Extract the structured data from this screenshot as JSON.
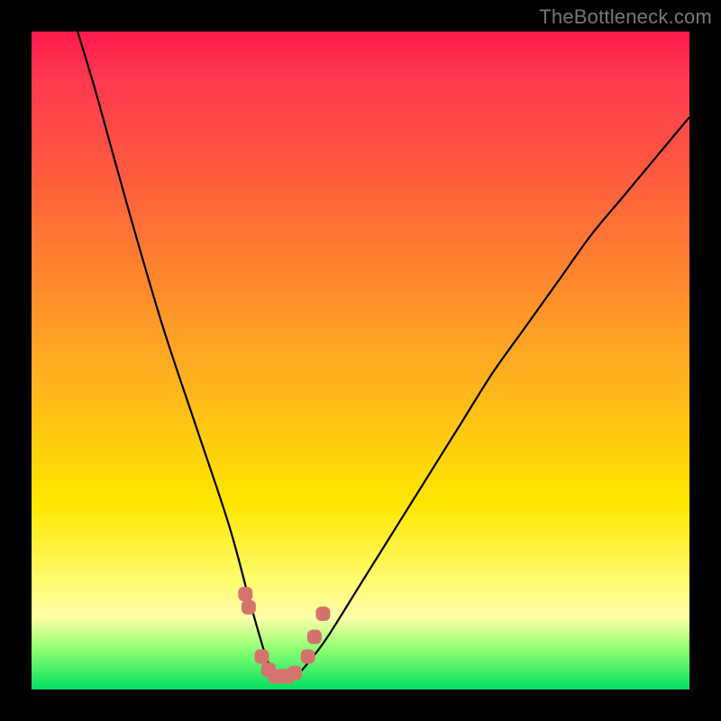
{
  "watermark": "TheBottleneck.com",
  "chart_data": {
    "type": "line",
    "title": "",
    "xlabel": "",
    "ylabel": "",
    "xlim": [
      0,
      100
    ],
    "ylim": [
      0,
      100
    ],
    "grid": false,
    "series": [
      {
        "name": "main-curve",
        "color": "#000000",
        "x": [
          7,
          10,
          15,
          20,
          25,
          30,
          33,
          35,
          36,
          37,
          38,
          40,
          42,
          45,
          50,
          55,
          60,
          65,
          70,
          75,
          80,
          85,
          90,
          95,
          100
        ],
        "y": [
          100,
          90,
          72,
          55,
          40,
          25,
          14,
          7,
          4,
          2,
          2,
          2,
          4,
          8,
          16,
          24,
          32,
          40,
          48,
          55,
          62,
          69,
          75,
          81,
          87
        ]
      },
      {
        "name": "trough-markers",
        "color": "#d4736e",
        "type": "scatter",
        "x": [
          32.5,
          33.0,
          35.0,
          36.0,
          37.0,
          38.0,
          39.0,
          40.0,
          42.0,
          43.0,
          44.3
        ],
        "y": [
          14.5,
          12.5,
          5.0,
          3.0,
          2.0,
          2.0,
          2.0,
          2.5,
          5.0,
          8.0,
          11.5
        ]
      }
    ],
    "gradient_bands": [
      {
        "y": 100,
        "color": "#ff1a4d"
      },
      {
        "y": 70,
        "color": "#ff7a30"
      },
      {
        "y": 40,
        "color": "#ffd820"
      },
      {
        "y": 15,
        "color": "#fffb6a"
      },
      {
        "y": 5,
        "color": "#8cff70"
      },
      {
        "y": 0,
        "color": "#00e060"
      }
    ]
  }
}
